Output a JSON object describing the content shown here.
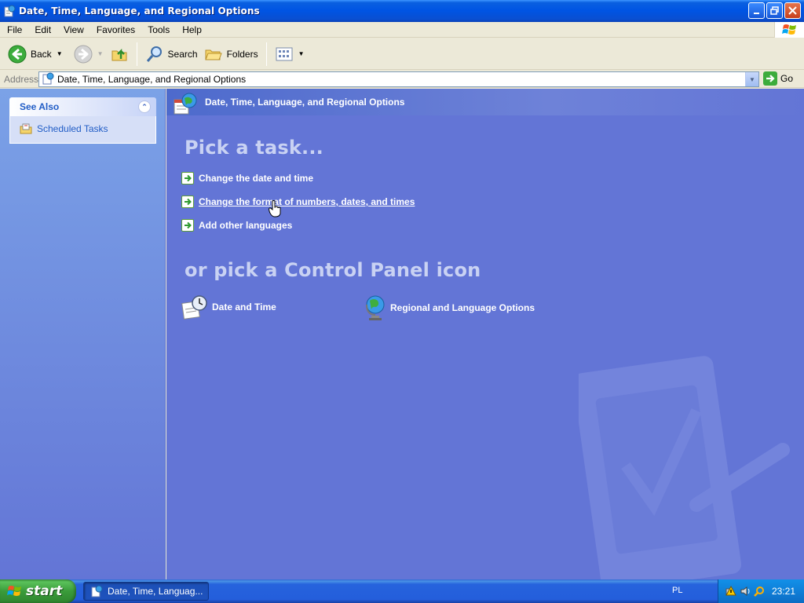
{
  "window": {
    "title": "Date, Time, Language, and Regional Options",
    "icon": "control-panel-icon"
  },
  "menu": [
    "File",
    "Edit",
    "View",
    "Favorites",
    "Tools",
    "Help"
  ],
  "toolbar": {
    "back_label": "Back",
    "search_label": "Search",
    "folders_label": "Folders"
  },
  "address": {
    "label": "Address",
    "value": "Date, Time, Language, and Regional Options",
    "go_label": "Go"
  },
  "see_also": {
    "title": "See Also",
    "items": [
      {
        "label": "Scheduled Tasks",
        "icon": "scheduled-tasks-icon"
      }
    ]
  },
  "main": {
    "header_title": "Date, Time, Language, and Regional Options",
    "pick_task_heading": "Pick a task...",
    "tasks": [
      {
        "label": "Change the date and time"
      },
      {
        "label": "Change the format of numbers, dates, and times"
      },
      {
        "label": "Add other languages"
      }
    ],
    "pick_icon_heading": "or pick a Control Panel icon",
    "icons": [
      {
        "label": "Date and Time",
        "icon": "date-time-icon"
      },
      {
        "label": "Regional and Language Options",
        "icon": "globe-icon"
      }
    ]
  },
  "taskbar": {
    "start_label": "start",
    "window_label": "Date, Time, Languag...",
    "language": "PL",
    "clock": "23:21"
  },
  "colors": {
    "main_bg": "#6375d6",
    "taskbar": "#245edb",
    "start_green": "#3a9b3a"
  }
}
